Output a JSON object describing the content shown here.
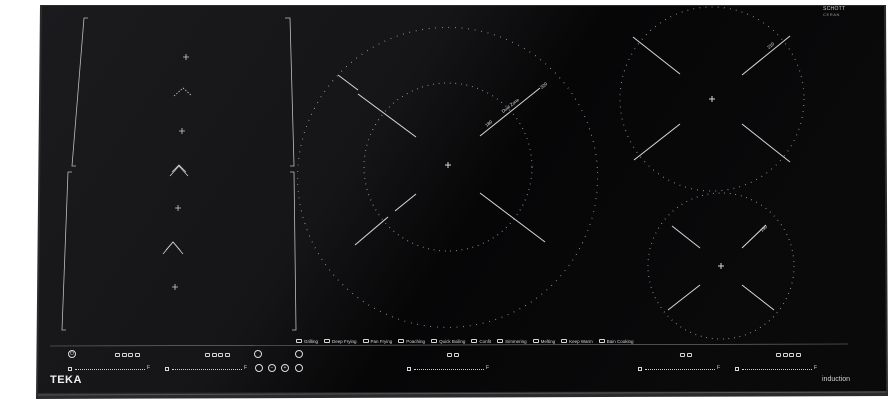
{
  "brand": {
    "schott": "SCHOTT",
    "ceran": "CERAN",
    "teka": "TEKA",
    "induction": "induction"
  },
  "zones": {
    "dual_zone": "Dual Zone",
    "dual_small": "180",
    "dual_large": "320",
    "top_right": "210",
    "bottom_right": "150"
  },
  "functions": [
    {
      "label": "Grilling"
    },
    {
      "label": "Deep Frying"
    },
    {
      "label": "Pan Frying"
    },
    {
      "label": "Poaching"
    },
    {
      "label": "Quick Boiling"
    },
    {
      "label": "Confit"
    },
    {
      "label": "Simmering"
    },
    {
      "label": "Melting"
    },
    {
      "label": "Keep Warm"
    },
    {
      "label": "Bain Cooking"
    }
  ],
  "controls": {
    "power_symbol": "⏻",
    "slider_end": "F",
    "timer_minus": "−",
    "timer_plus": "+"
  },
  "colors": {
    "glass": "#0b0b0d",
    "frame": "#2a2a2c",
    "print": "#d6d6d6"
  }
}
